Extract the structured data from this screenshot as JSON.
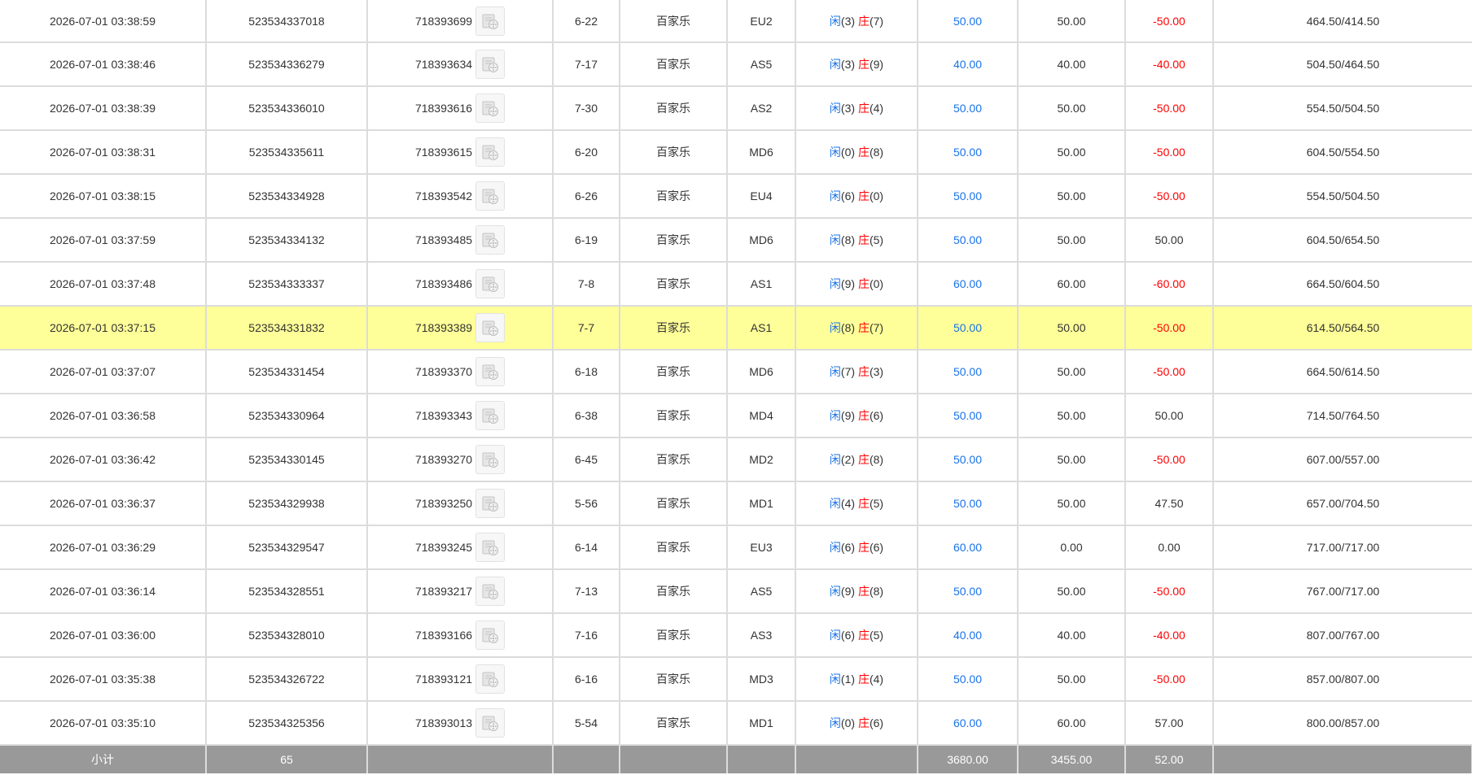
{
  "columns": [
    "time",
    "bet_id",
    "game_id",
    "shoe_round",
    "game_type",
    "table",
    "result",
    "bet_amount",
    "valid_bet",
    "win_loss",
    "balance"
  ],
  "result_labels": {
    "player": "闲",
    "banker": "庄"
  },
  "rows": [
    {
      "time": "2026-07-01 03:38:59",
      "bet_id": "523534337018",
      "game_id": "718393699",
      "round": "6-22",
      "game": "百家乐",
      "table": "EU2",
      "player": "(3)",
      "banker": "(7)",
      "bet": "50.00",
      "valid": "50.00",
      "win": "-50.00",
      "win_color": "red",
      "balance": "464.50/414.50"
    },
    {
      "time": "2026-07-01 03:38:46",
      "bet_id": "523534336279",
      "game_id": "718393634",
      "round": "7-17",
      "game": "百家乐",
      "table": "AS5",
      "player": "(3)",
      "banker": "(9)",
      "bet": "40.00",
      "valid": "40.00",
      "win": "-40.00",
      "win_color": "red",
      "balance": "504.50/464.50"
    },
    {
      "time": "2026-07-01 03:38:39",
      "bet_id": "523534336010",
      "game_id": "718393616",
      "round": "7-30",
      "game": "百家乐",
      "table": "AS2",
      "player": "(3)",
      "banker": "(4)",
      "bet": "50.00",
      "valid": "50.00",
      "win": "-50.00",
      "win_color": "red",
      "balance": "554.50/504.50"
    },
    {
      "time": "2026-07-01 03:38:31",
      "bet_id": "523534335611",
      "game_id": "718393615",
      "round": "6-20",
      "game": "百家乐",
      "table": "MD6",
      "player": "(0)",
      "banker": "(8)",
      "bet": "50.00",
      "valid": "50.00",
      "win": "-50.00",
      "win_color": "red",
      "balance": "604.50/554.50"
    },
    {
      "time": "2026-07-01 03:38:15",
      "bet_id": "523534334928",
      "game_id": "718393542",
      "round": "6-26",
      "game": "百家乐",
      "table": "EU4",
      "player": "(6)",
      "banker": "(0)",
      "bet": "50.00",
      "valid": "50.00",
      "win": "-50.00",
      "win_color": "red",
      "balance": "554.50/504.50"
    },
    {
      "time": "2026-07-01 03:37:59",
      "bet_id": "523534334132",
      "game_id": "718393485",
      "round": "6-19",
      "game": "百家乐",
      "table": "MD6",
      "player": "(8)",
      "banker": "(5)",
      "bet": "50.00",
      "valid": "50.00",
      "win": "50.00",
      "win_color": "normal",
      "balance": "604.50/654.50"
    },
    {
      "time": "2026-07-01 03:37:48",
      "bet_id": "523534333337",
      "game_id": "718393486",
      "round": "7-8",
      "game": "百家乐",
      "table": "AS1",
      "player": "(9)",
      "banker": "(0)",
      "bet": "60.00",
      "valid": "60.00",
      "win": "-60.00",
      "win_color": "red",
      "balance": "664.50/604.50"
    },
    {
      "time": "2026-07-01 03:37:15",
      "bet_id": "523534331832",
      "game_id": "718393389",
      "round": "7-7",
      "game": "百家乐",
      "table": "AS1",
      "player": "(8)",
      "banker": "(7)",
      "bet": "50.00",
      "valid": "50.00",
      "win": "-50.00",
      "win_color": "red",
      "balance": "614.50/564.50",
      "highlight": true
    },
    {
      "time": "2026-07-01 03:37:07",
      "bet_id": "523534331454",
      "game_id": "718393370",
      "round": "6-18",
      "game": "百家乐",
      "table": "MD6",
      "player": "(7)",
      "banker": "(3)",
      "bet": "50.00",
      "valid": "50.00",
      "win": "-50.00",
      "win_color": "red",
      "balance": "664.50/614.50"
    },
    {
      "time": "2026-07-01 03:36:58",
      "bet_id": "523534330964",
      "game_id": "718393343",
      "round": "6-38",
      "game": "百家乐",
      "table": "MD4",
      "player": "(9)",
      "banker": "(6)",
      "bet": "50.00",
      "valid": "50.00",
      "win": "50.00",
      "win_color": "normal",
      "balance": "714.50/764.50"
    },
    {
      "time": "2026-07-01 03:36:42",
      "bet_id": "523534330145",
      "game_id": "718393270",
      "round": "6-45",
      "game": "百家乐",
      "table": "MD2",
      "player": "(2)",
      "banker": "(8)",
      "bet": "50.00",
      "valid": "50.00",
      "win": "-50.00",
      "win_color": "red",
      "balance": "607.00/557.00"
    },
    {
      "time": "2026-07-01 03:36:37",
      "bet_id": "523534329938",
      "game_id": "718393250",
      "round": "5-56",
      "game": "百家乐",
      "table": "MD1",
      "player": "(4)",
      "banker": "(5)",
      "bet": "50.00",
      "valid": "50.00",
      "win": "47.50",
      "win_color": "normal",
      "balance": "657.00/704.50"
    },
    {
      "time": "2026-07-01 03:36:29",
      "bet_id": "523534329547",
      "game_id": "718393245",
      "round": "6-14",
      "game": "百家乐",
      "table": "EU3",
      "player": "(6)",
      "banker": "(6)",
      "bet": "60.00",
      "valid": "0.00",
      "win": "0.00",
      "win_color": "normal",
      "balance": "717.00/717.00"
    },
    {
      "time": "2026-07-01 03:36:14",
      "bet_id": "523534328551",
      "game_id": "718393217",
      "round": "7-13",
      "game": "百家乐",
      "table": "AS5",
      "player": "(9)",
      "banker": "(8)",
      "bet": "50.00",
      "valid": "50.00",
      "win": "-50.00",
      "win_color": "red",
      "balance": "767.00/717.00"
    },
    {
      "time": "2026-07-01 03:36:00",
      "bet_id": "523534328010",
      "game_id": "718393166",
      "round": "7-16",
      "game": "百家乐",
      "table": "AS3",
      "player": "(6)",
      "banker": "(5)",
      "bet": "40.00",
      "valid": "40.00",
      "win": "-40.00",
      "win_color": "red",
      "balance": "807.00/767.00"
    },
    {
      "time": "2026-07-01 03:35:38",
      "bet_id": "523534326722",
      "game_id": "718393121",
      "round": "6-16",
      "game": "百家乐",
      "table": "MD3",
      "player": "(1)",
      "banker": "(4)",
      "bet": "50.00",
      "valid": "50.00",
      "win": "-50.00",
      "win_color": "red",
      "balance": "857.00/807.00"
    },
    {
      "time": "2026-07-01 03:35:10",
      "bet_id": "523534325356",
      "game_id": "718393013",
      "round": "5-54",
      "game": "百家乐",
      "table": "MD1",
      "player": "(0)",
      "banker": "(6)",
      "bet": "60.00",
      "valid": "60.00",
      "win": "57.00",
      "win_color": "normal",
      "balance": "800.00/857.00"
    }
  ],
  "subtotal": {
    "label": "小计",
    "count": "65",
    "bet": "3680.00",
    "valid": "3455.00",
    "win": "52.00"
  },
  "icons": {
    "replay": "video-replay-icon"
  },
  "colors": {
    "highlight": "#ffff99",
    "blue": "#1a73e8",
    "red": "#ff0000",
    "subtotal_bg": "#999999"
  }
}
